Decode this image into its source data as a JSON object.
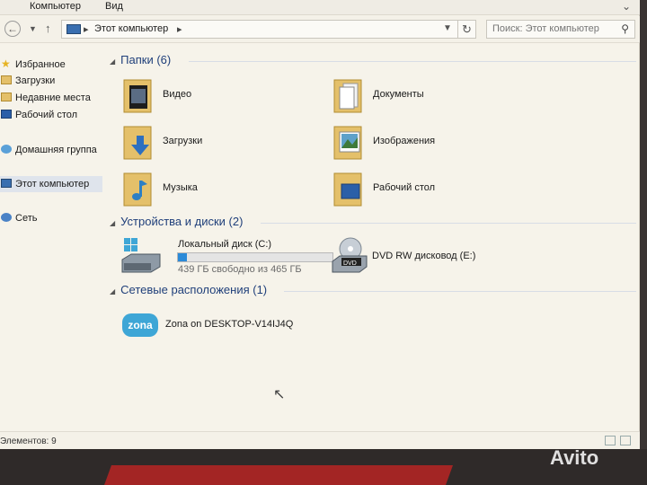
{
  "menubar": {
    "items": [
      "Компьютер",
      "Вид"
    ]
  },
  "address": {
    "crumb": "Этот компьютер",
    "search_placeholder": "Поиск: Этот компьютер"
  },
  "sidebar": {
    "items": [
      {
        "label": "Избранное",
        "icon": "star-icon"
      },
      {
        "label": "Загрузки",
        "icon": "downloads-folder-icon"
      },
      {
        "label": "Недавние места",
        "icon": "recent-places-icon"
      },
      {
        "label": "Рабочий стол",
        "icon": "desktop-icon"
      },
      {
        "label": "Домашняя группа",
        "icon": "homegroup-icon"
      },
      {
        "label": "Этот компьютер",
        "icon": "computer-icon"
      },
      {
        "label": "Сеть",
        "icon": "network-icon"
      }
    ]
  },
  "groups": {
    "folders": "Папки (6)",
    "devices": "Устройства и диски (2)",
    "network": "Сетевые расположения (1)"
  },
  "folders": [
    {
      "label": "Видео",
      "icon": "videos-folder-icon"
    },
    {
      "label": "Документы",
      "icon": "documents-folder-icon"
    },
    {
      "label": "Загрузки",
      "icon": "downloads-folder-icon"
    },
    {
      "label": "Изображения",
      "icon": "pictures-folder-icon"
    },
    {
      "label": "Музыка",
      "icon": "music-folder-icon"
    },
    {
      "label": "Рабочий стол",
      "icon": "desktop-folder-icon"
    }
  ],
  "drives": [
    {
      "label": "Локальный диск (C:)",
      "free": "439 ГБ свободно из 465 ГБ",
      "used_fraction": 0.056,
      "icon": "local-disk-icon"
    },
    {
      "label": "DVD RW дисковод (E:)",
      "icon": "dvd-drive-icon",
      "badge": "DVD"
    }
  ],
  "network_locations": [
    {
      "label": "Zona on DESKTOP-V14IJ4Q",
      "logo": "zona"
    }
  ],
  "status": {
    "count": "Элементов: 9"
  },
  "watermark": "Avito",
  "colors": {
    "accent": "#1f3f7a",
    "progress": "#2b8ad8",
    "folder": "#e4c06a"
  }
}
